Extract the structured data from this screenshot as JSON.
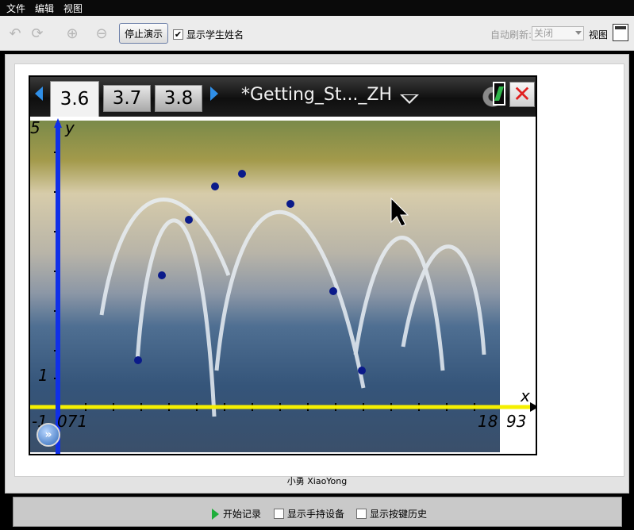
{
  "menu": {
    "file": "文件",
    "edit": "编辑",
    "view": "视图"
  },
  "toolbar": {
    "stop_demo_label": "停止演示",
    "show_student_names_label": "显示学生姓名",
    "show_student_names_checked": true,
    "auto_refresh_label": "自动刷新:",
    "auto_refresh_value": "关闭",
    "view_label": "视图"
  },
  "handheld": {
    "tabs": [
      {
        "label": "3.6",
        "active": true
      },
      {
        "label": "3.7",
        "active": false
      },
      {
        "label": "3.8",
        "active": false
      }
    ],
    "document_title": "*Getting_St..._ZH"
  },
  "graph": {
    "y_axis_label": "y",
    "x_axis_label": "x",
    "y_max_tick": "5",
    "y_tick_1": "1",
    "x_min_tick": "-1",
    "x_tick_071": "071",
    "x_tick_18": "18",
    "x_max_tick": "93",
    "points_color": "#0a1a8a",
    "x_axis_color": "#f5f000",
    "y_axis_color": "#1030e8"
  },
  "student": {
    "name": "小勇 XiaoYong"
  },
  "bottom": {
    "start_record_label": "开始记录",
    "show_handheld_label": "显示手持设备",
    "show_key_history_label": "显示按键历史"
  }
}
